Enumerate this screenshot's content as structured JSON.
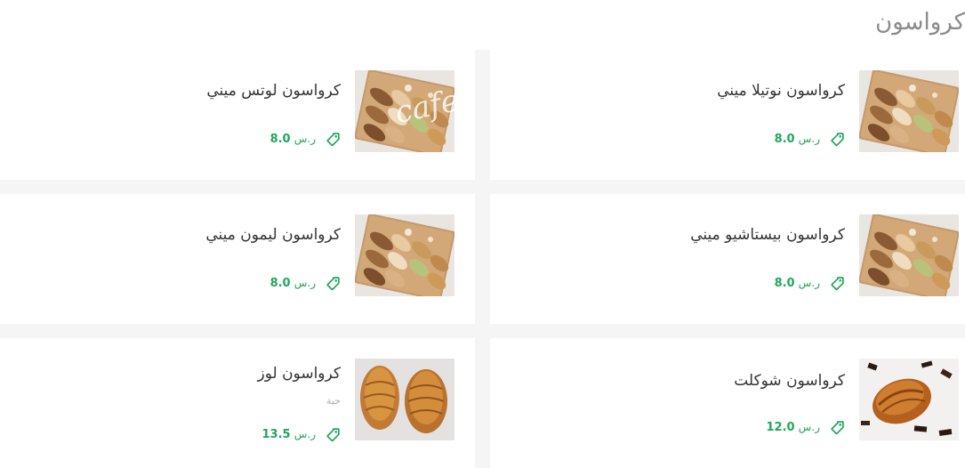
{
  "section": {
    "title": "كرواسون"
  },
  "items": [
    {
      "name": "كرواسون نوتيلا ميني",
      "subtitle": "",
      "price": "8.0",
      "currency": "ر.س",
      "image": "mini-croissant-board"
    },
    {
      "name": "كرواسون لوتس ميني",
      "subtitle": "",
      "price": "8.0",
      "currency": "ر.س",
      "image": "mini-croissant-board"
    },
    {
      "name": "كرواسون بيستاشيو ميني",
      "subtitle": "",
      "price": "8.0",
      "currency": "ر.س",
      "image": "mini-croissant-board"
    },
    {
      "name": "كرواسون ليمون ميني",
      "subtitle": "",
      "price": "8.0",
      "currency": "ر.س",
      "image": "mini-croissant-board"
    },
    {
      "name": "كرواسون شوكلت",
      "subtitle": "",
      "price": "12.0",
      "currency": "ر.س",
      "image": "pain-au-chocolat"
    },
    {
      "name": "كرواسون لوز",
      "subtitle": "حبة",
      "price": "13.5",
      "currency": "ر.س",
      "image": "almond-croissants"
    }
  ],
  "watermark": "cafe",
  "colors": {
    "price": "#1fa75a",
    "title": "#8b8b8b",
    "background": "#f5f5f5"
  },
  "icons": {
    "price": "tag-icon"
  }
}
